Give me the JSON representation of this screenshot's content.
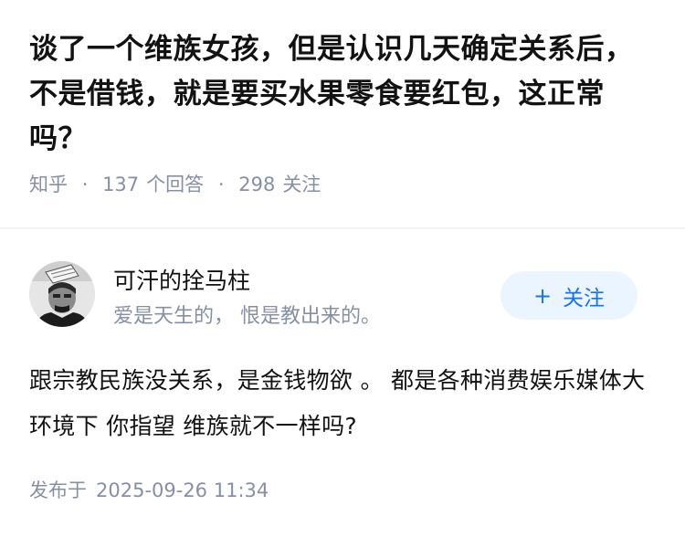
{
  "question": {
    "title": "谈了一个维族女孩，但是认识几天确定关系后，不是借钱，就是要买水果零食要红包，这正常吗？",
    "source": "知乎",
    "separator": "·",
    "answer_count": "137",
    "answer_label": "个回答",
    "follower_count": "298",
    "follower_label": "关注"
  },
  "answer": {
    "author_name": "可汗的拴马柱",
    "author_bio": "爱是天生的， 恨是教出来的。",
    "follow_plus": "+",
    "follow_label": "关注",
    "content": "跟宗教民族没关系，是金钱物欲 。 都是各种消费娱乐媒体大环境下 你指望 维族就不一样吗?",
    "publish_label": "发布于",
    "publish_time": "2025-09-26 11:34"
  },
  "colors": {
    "title": "#121212",
    "meta": "#8590a6",
    "accent": "#1772f6",
    "follow_bg": "#ebf5ff"
  },
  "icons": {
    "avatar": "avatar-portrait"
  }
}
